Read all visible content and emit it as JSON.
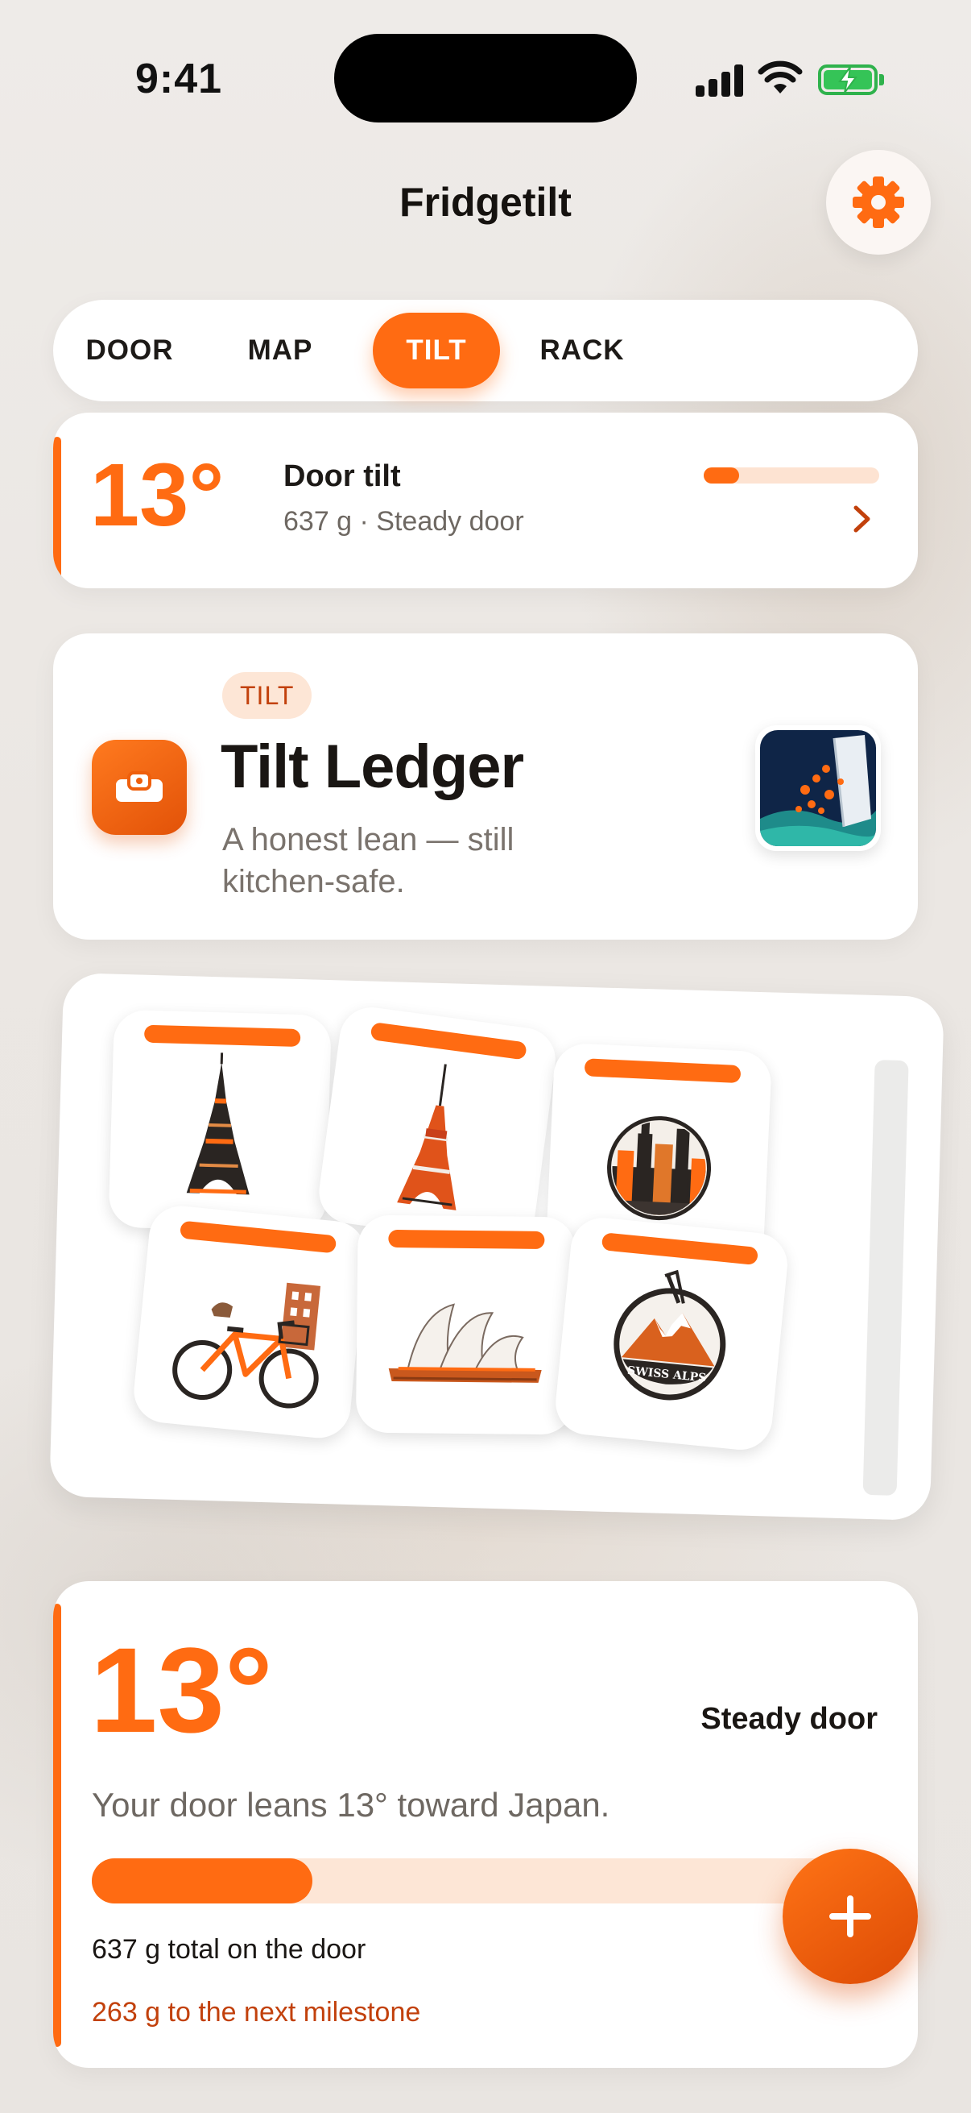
{
  "status": {
    "time": "9:41"
  },
  "header": {
    "title": "Fridgetilt",
    "settings_icon": "gear-icon"
  },
  "tabs": [
    {
      "label": "DOOR"
    },
    {
      "label": "MAP"
    },
    {
      "label": "TILT",
      "active": true
    },
    {
      "label": "RACK"
    }
  ],
  "summary": {
    "degrees": "13°",
    "label": "Door tilt",
    "subtitle": "637 g · Steady door",
    "progress": 0.2
  },
  "ledger": {
    "badge": "TILT",
    "title": "Tilt Ledger",
    "description": "A honest lean — still kitchen-safe.",
    "icon": "spirit-level-icon",
    "thumbnail": "fridge-magnets-thumbnail"
  },
  "board": {
    "magnets": [
      {
        "name": "eiffel-tower-magnet"
      },
      {
        "name": "tokyo-tower-magnet"
      },
      {
        "name": "new-york-skyline-magnet"
      },
      {
        "name": "bicycle-magnet"
      },
      {
        "name": "sydney-opera-house-magnet"
      },
      {
        "name": "swiss-alps-magnet",
        "text": "SWISS ALPS"
      }
    ]
  },
  "stats": {
    "degrees": "13°",
    "state": "Steady door",
    "sentence": "Your door leans 13° toward Japan.",
    "progress": 0.28,
    "total": "637 g total on the door",
    "next": "263 g to the next milestone"
  },
  "fab": {
    "icon": "plus-icon"
  },
  "colors": {
    "accent": "#ff6b12",
    "accent_dark": "#c2410c",
    "track": "#fde6d6"
  }
}
